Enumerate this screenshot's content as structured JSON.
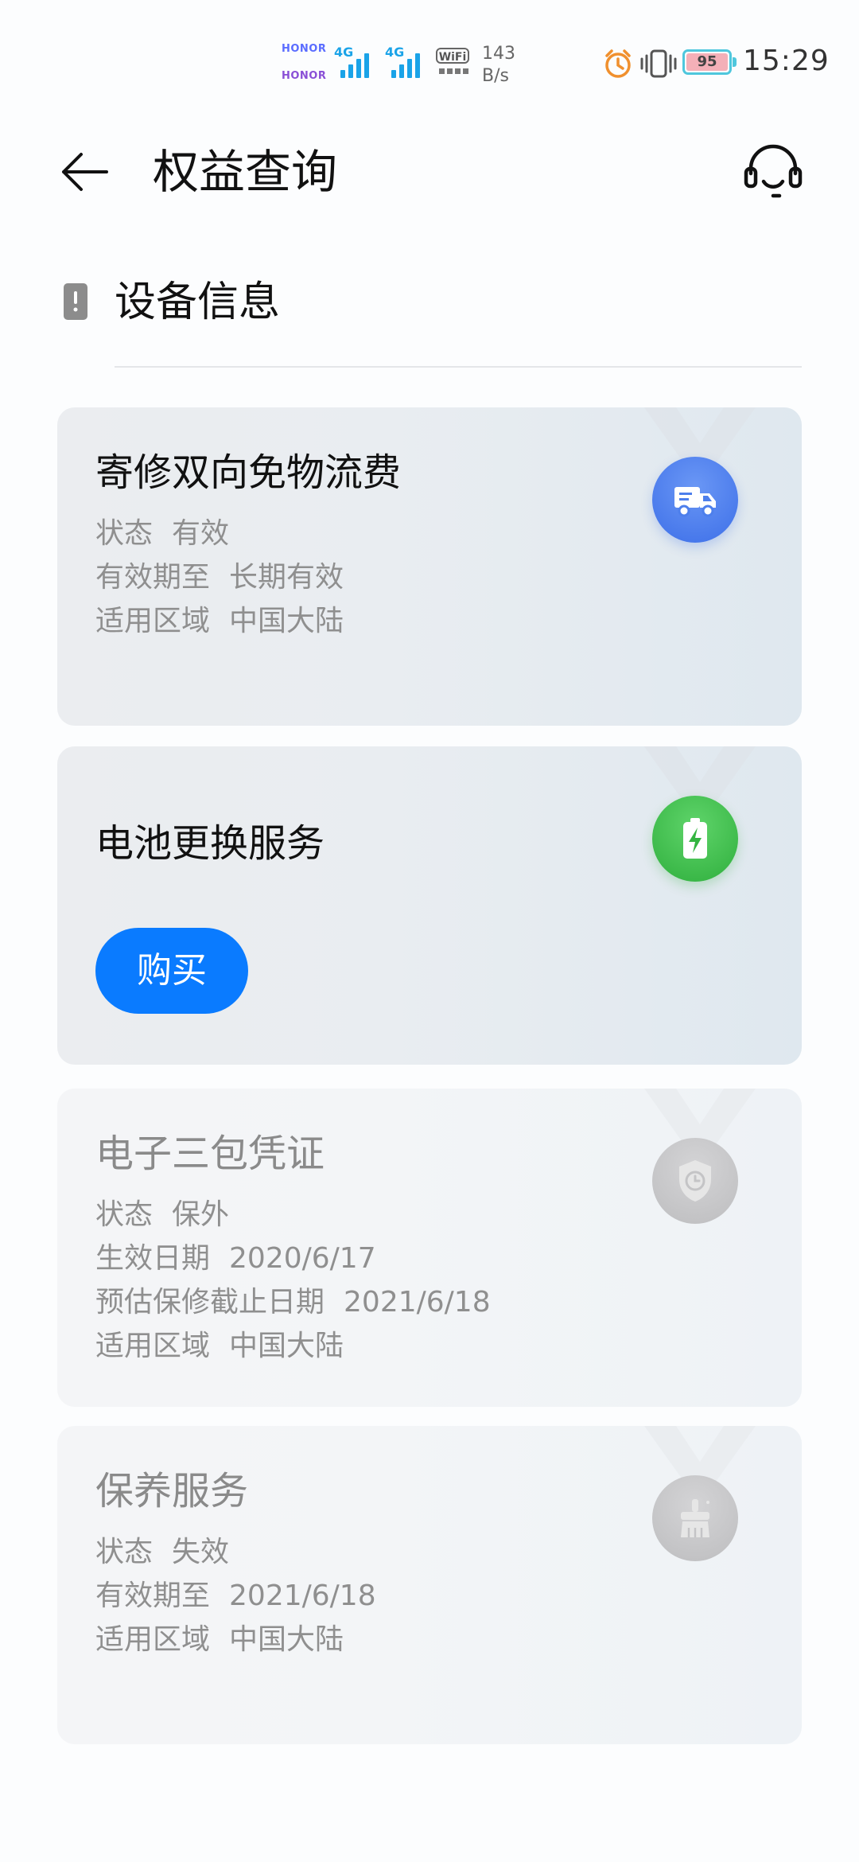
{
  "status_bar": {
    "carrier1": "HONOR",
    "carrier2": "HONOR",
    "sig1_label": "4G",
    "sig2_label": "4G",
    "wifi_label": "WiFi",
    "net_speed_value": "143",
    "net_speed_unit": "B/s",
    "battery": "95",
    "time": "15:29",
    "icons": [
      "alarm-icon",
      "vibrate-icon",
      "battery-icon"
    ]
  },
  "header": {
    "title": "权益查询",
    "back_icon": "arrow-left-icon",
    "support_icon": "headset-icon"
  },
  "section": {
    "icon": "device-icon",
    "title": "设备信息"
  },
  "cards": [
    {
      "title": "寄修双向免物流费",
      "icon": "truck-icon",
      "status": "active",
      "rows": [
        {
          "label": "状态",
          "value": "有效"
        },
        {
          "label": "有效期至",
          "value": "长期有效"
        },
        {
          "label": "适用区域",
          "value": "中国大陆"
        }
      ]
    },
    {
      "title": "电池更换服务",
      "icon": "battery-bolt-icon",
      "status": "active",
      "button_label": "购买"
    },
    {
      "title": "电子三包凭证",
      "icon": "shield-clock-icon",
      "status": "inactive",
      "rows": [
        {
          "label": "状态",
          "value": "保外"
        },
        {
          "label": "生效日期",
          "value": "2020/6/17"
        },
        {
          "label": "预估保修截止日期",
          "value": "2021/6/18"
        },
        {
          "label": "适用区域",
          "value": "中国大陆"
        }
      ]
    },
    {
      "title": "保养服务",
      "icon": "brush-icon",
      "status": "inactive",
      "rows": [
        {
          "label": "状态",
          "value": "失效"
        },
        {
          "label": "有效期至",
          "value": "2021/6/18"
        },
        {
          "label": "适用区域",
          "value": "中国大陆"
        }
      ]
    }
  ],
  "colors": {
    "accent": "#0A7BFF",
    "truck_badge": "#3D6FE8",
    "battery_badge": "#2FAF3D",
    "inactive_badge": "#BDBDBF"
  }
}
